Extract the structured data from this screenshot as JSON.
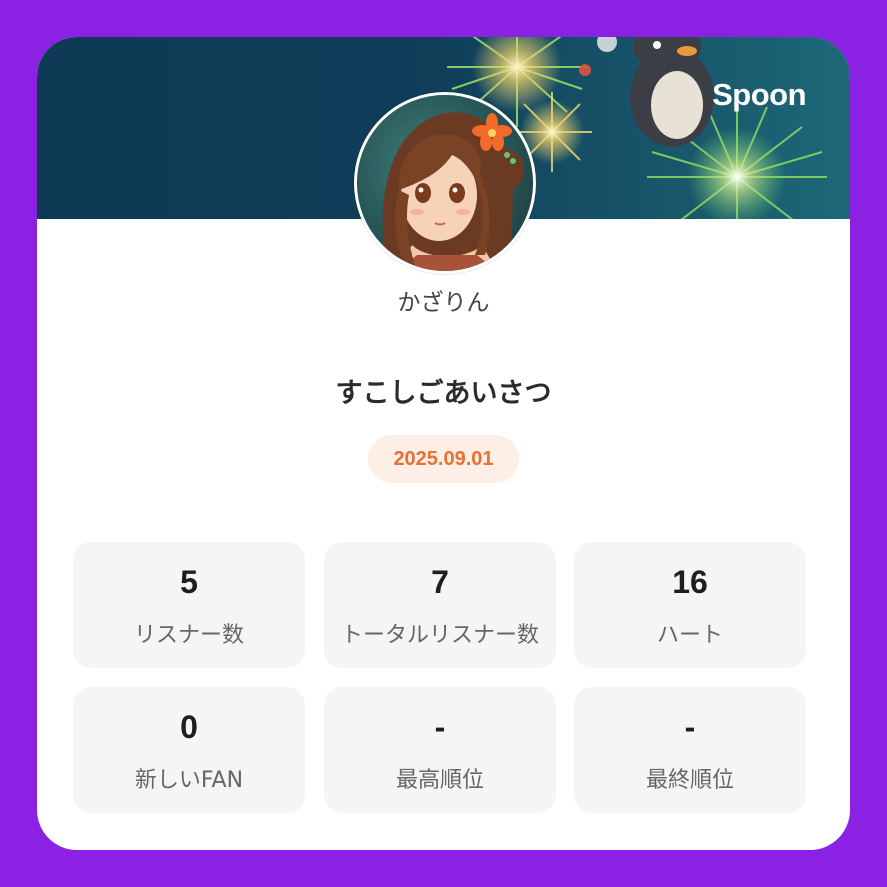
{
  "brand": {
    "name": "Spoon"
  },
  "profile": {
    "username": "かざりん",
    "avatar_icon": "anime-girl-avatar"
  },
  "broadcast": {
    "title": "すこしごあいさつ",
    "date": "2025.09.01"
  },
  "stats": [
    {
      "value": "5",
      "label": "リスナー数"
    },
    {
      "value": "7",
      "label": "トータルリスナー数"
    },
    {
      "value": "16",
      "label": "ハート"
    },
    {
      "value": "0",
      "label": "新しいFAN"
    },
    {
      "value": "-",
      "label": "最高順位"
    },
    {
      "value": "-",
      "label": "最終順位"
    }
  ],
  "colors": {
    "frame": "#8b22e3",
    "accent": "#e57234",
    "badge_bg": "#fdeee6",
    "stat_bg": "#f5f5f5"
  }
}
